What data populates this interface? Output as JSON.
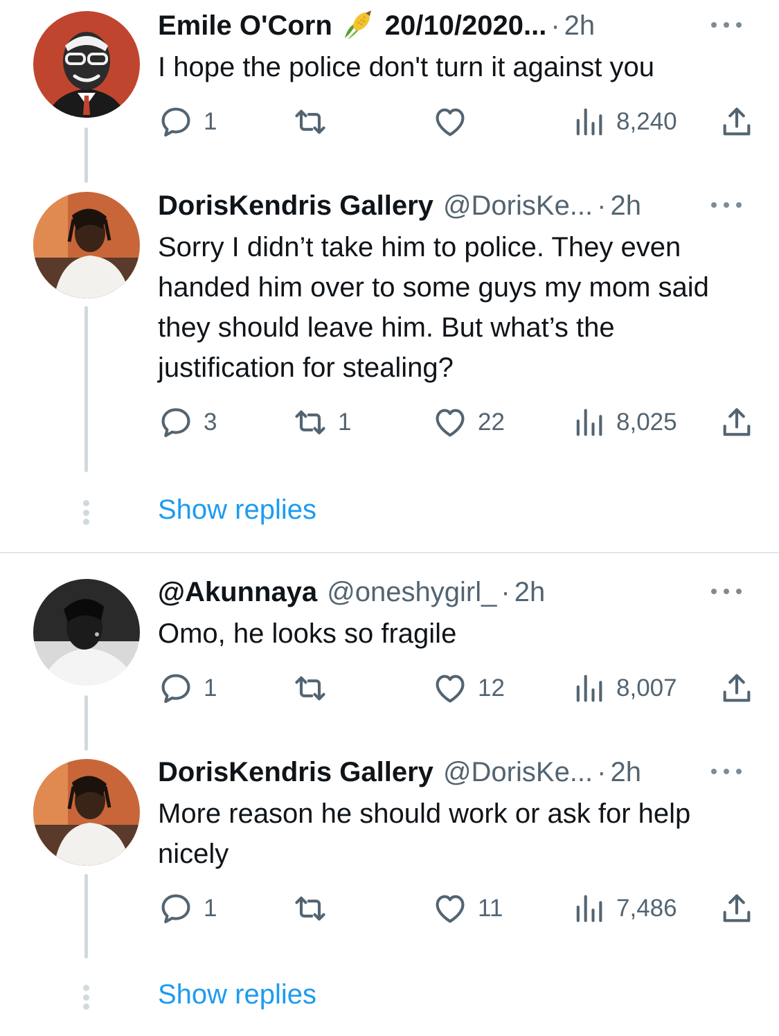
{
  "tweets": [
    {
      "name": "Emile O'Corn",
      "handle": "",
      "date": "20/10/2020...",
      "time": "2h",
      "text": "I hope the police don't turn it against you",
      "replies": "1",
      "retweets": "",
      "likes": "",
      "views": "8,240"
    },
    {
      "name": "DorisKendris Gallery",
      "handle": "@DorisKe...",
      "time": "2h",
      "text": "Sorry I didn’t take him to police. They even handed him over to some guys my mom said they should leave him. But what’s the justification for stealing?",
      "replies": "3",
      "retweets": "1",
      "likes": "22",
      "views": "8,025"
    },
    {
      "name": "@Akunnaya",
      "handle": "@oneshygirl_",
      "time": "2h",
      "text": "Omo, he looks so fragile",
      "replies": "1",
      "retweets": "",
      "likes": "12",
      "views": "8,007"
    },
    {
      "name": "DorisKendris Gallery",
      "handle": "@DorisKe...",
      "time": "2h",
      "text": "More reason he should work or ask for help nicely",
      "replies": "1",
      "retweets": "",
      "likes": "11",
      "views": "7,486"
    }
  ],
  "show_replies_label": "Show replies",
  "separator": "·",
  "colors": {
    "accent": "#1d9bf0",
    "secondary_text": "#536471",
    "thread_line": "#cfd9de"
  },
  "icons": [
    "reply-icon",
    "retweet-icon",
    "like-icon",
    "views-icon",
    "share-icon",
    "more-icon",
    "corn-emoji"
  ]
}
